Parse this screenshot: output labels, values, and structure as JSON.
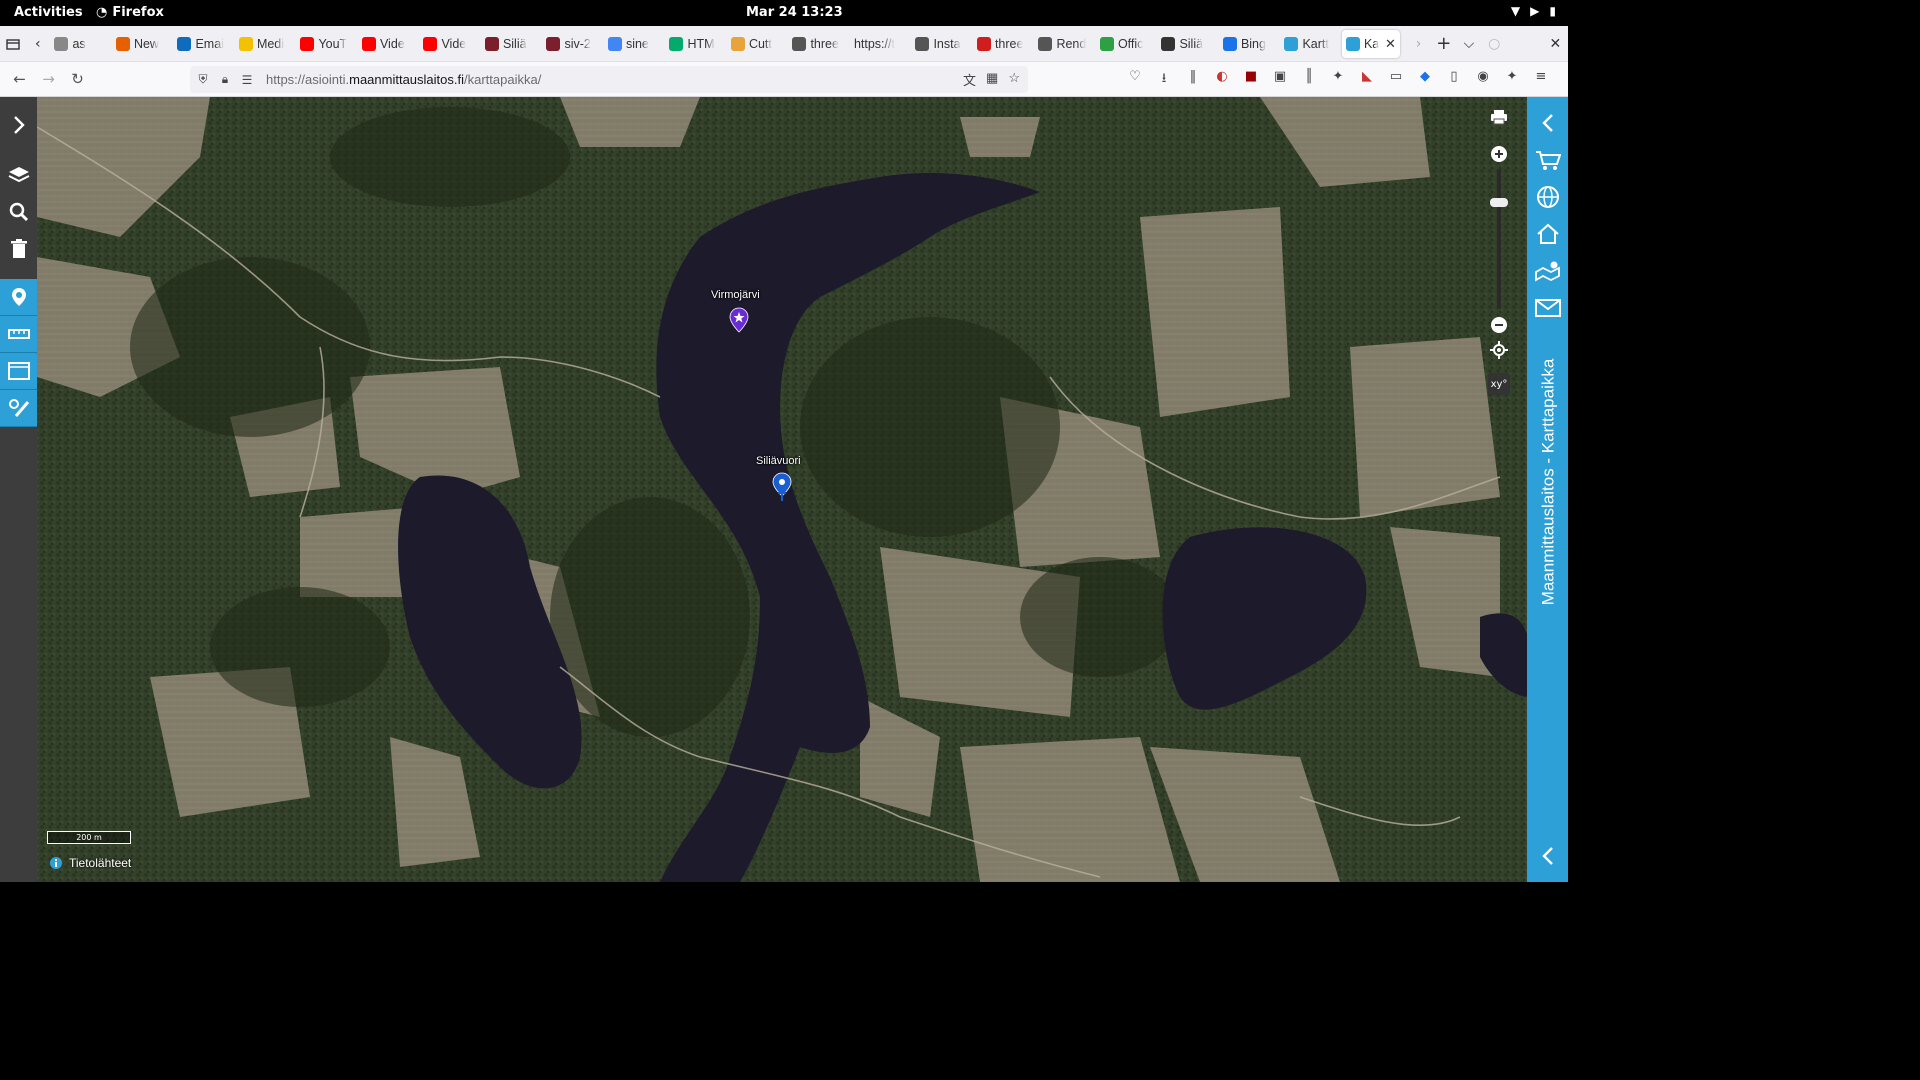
{
  "topbar": {
    "activities": "Activities",
    "app": "Firefox",
    "clock": "Mar 24  13:23"
  },
  "tabs": [
    {
      "label": "as",
      "icon": "generic-tab-icon",
      "color": "#888888"
    },
    {
      "label": "New",
      "icon": "firefox-icon",
      "color": "#e66000"
    },
    {
      "label": "Emai",
      "icon": "outlook-icon",
      "color": "#0f6cbd"
    },
    {
      "label": "Medi",
      "icon": "folder-icon",
      "color": "#f2c200"
    },
    {
      "label": "YouT",
      "icon": "youtube-icon",
      "color": "#ff0000"
    },
    {
      "label": "Vide",
      "icon": "youtube-icon",
      "color": "#ff0000"
    },
    {
      "label": "Vide",
      "icon": "youtube-icon",
      "color": "#ff0000"
    },
    {
      "label": "Siliä",
      "icon": "anchor-icon",
      "color": "#7a1f2b"
    },
    {
      "label": "siv-2",
      "icon": "anchor-icon",
      "color": "#7a1f2b"
    },
    {
      "label": "sine",
      "icon": "google-icon",
      "color": "#4285f4"
    },
    {
      "label": "HTM",
      "icon": "w3-icon",
      "color": "#04aa6d"
    },
    {
      "label": "Cutt",
      "icon": "cutter-icon",
      "color": "#e8a33a"
    },
    {
      "label": "three",
      "icon": "bookmark-flag-icon",
      "color": "#555555"
    },
    {
      "label": "https://t",
      "icon": "none",
      "color": "#ffffff"
    },
    {
      "label": "Insta",
      "icon": "bookmark-flag-icon",
      "color": "#555555"
    },
    {
      "label": "three",
      "icon": "threejs-icon",
      "color": "#d01e1e"
    },
    {
      "label": "Rend",
      "icon": "bookmark-flag-icon",
      "color": "#555555"
    },
    {
      "label": "Offic",
      "icon": "office-icon",
      "color": "#2ea043"
    },
    {
      "label": "Siliä",
      "icon": "wikipedia-icon",
      "color": "#333333"
    },
    {
      "label": "Bing",
      "icon": "bing-search-icon",
      "color": "#1a73e8"
    },
    {
      "label": "Kartt",
      "icon": "mml-icon",
      "color": "#2da0d8"
    },
    {
      "label": "Ka",
      "icon": "mml-icon",
      "color": "#2da0d8"
    }
  ],
  "url": {
    "prefix": "https://asiointi.",
    "domain": "maanmittauslaitos.fi",
    "path": "/karttapaikka/"
  },
  "map": {
    "labels": {
      "virmojarvi": "Virmojärvi",
      "siliavuori": "Siliävuori"
    },
    "scale_label": "200 m",
    "sources_label": "Tietolähteet",
    "panel_title": "Maanmittauslaitos - Karttapaikka",
    "coord_button": "xy°"
  },
  "colors": {
    "accent": "#2da0d8",
    "toolbar": "#3d3d3d",
    "water": "#1a1a2a",
    "forest": "#2f3a22",
    "field": "#8c8372"
  }
}
